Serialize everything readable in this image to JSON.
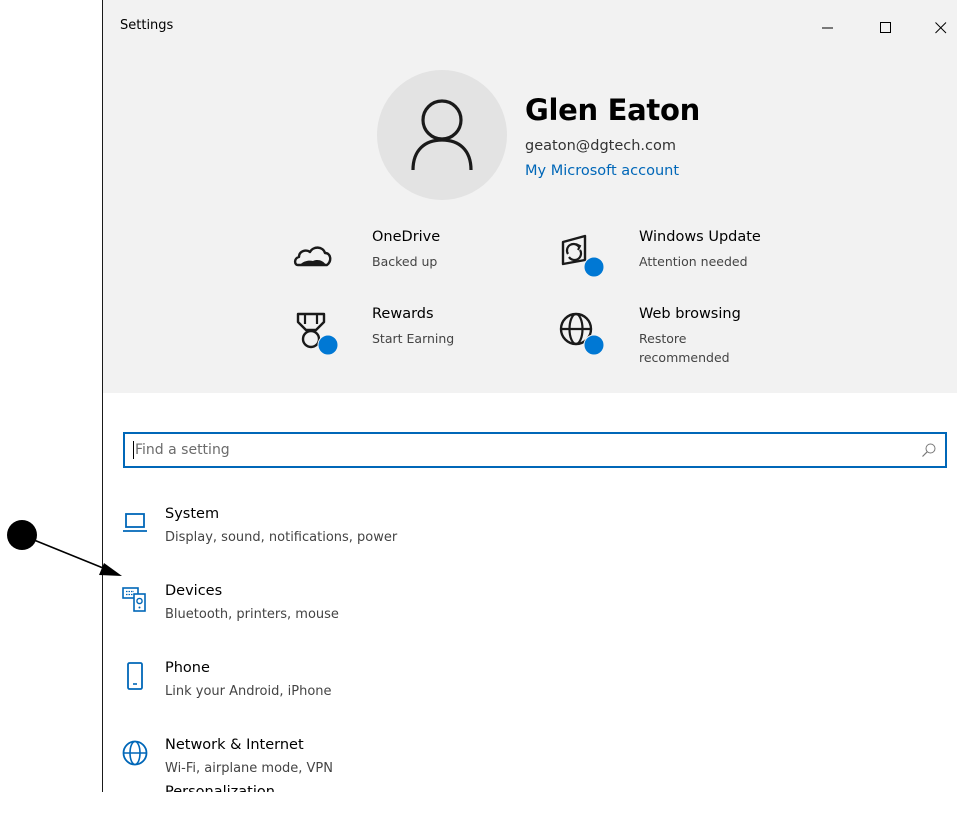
{
  "window": {
    "title": "Settings",
    "controls": {
      "minimize": "minimize",
      "maximize": "maximize",
      "close": "close"
    }
  },
  "profile": {
    "name": "Glen Eaton",
    "email": "geaton@dgtech.com",
    "account_link": "My Microsoft account",
    "avatar_icon": "person-icon"
  },
  "tiles": [
    {
      "title": "OneDrive",
      "subtitle": "Backed up",
      "icon": "cloud-icon",
      "badge": false
    },
    {
      "title": "Windows Update",
      "subtitle": "Attention needed",
      "icon": "sync-icon",
      "badge": true
    },
    {
      "title": "Rewards",
      "subtitle": "Start Earning",
      "icon": "medal-icon",
      "badge": true
    },
    {
      "title": "Web browsing",
      "subtitle": "Restore recommended",
      "icon": "globe-icon",
      "badge": true
    }
  ],
  "search": {
    "placeholder": "Find a setting",
    "value": ""
  },
  "categories": [
    {
      "title": "System",
      "description": "Display, sound, notifications, power",
      "icon": "laptop-icon"
    },
    {
      "title": "Devices",
      "description": "Bluetooth, printers, mouse",
      "icon": "devices-icon"
    },
    {
      "title": "Phone",
      "description": "Link your Android, iPhone",
      "icon": "phone-icon"
    },
    {
      "title": "Network & Internet",
      "description": "Wi-Fi, airplane mode, VPN",
      "icon": "globe-icon"
    },
    {
      "title": "Personalization",
      "description": "",
      "icon": "personalization-icon"
    }
  ],
  "colors": {
    "accent": "#0067b8",
    "header_bg": "#f2f2f2",
    "badge": "#0078d4"
  }
}
